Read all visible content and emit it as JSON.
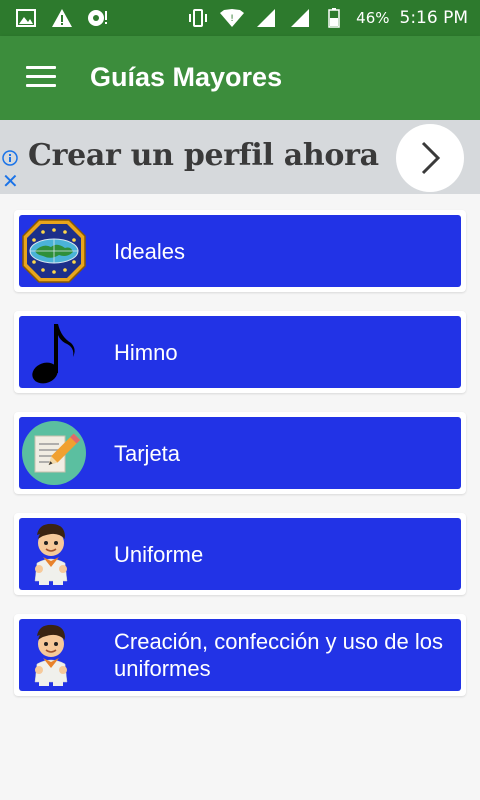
{
  "status_bar": {
    "battery_percent": "46%",
    "time": "5:16 PM"
  },
  "app_bar": {
    "title": "Guías Mayores"
  },
  "ad": {
    "text": "Crear un perfil ahora",
    "close_glyph": "✕"
  },
  "items": [
    {
      "label": "Ideales",
      "icon": "emblem-globe-icon"
    },
    {
      "label": "Himno",
      "icon": "music-note-icon"
    },
    {
      "label": "Tarjeta",
      "icon": "notepad-pencil-icon"
    },
    {
      "label": "Uniforme",
      "icon": "scout-boy-icon"
    },
    {
      "label": "Creación, confección y uso de los uniformes",
      "icon": "scout-boy-icon"
    }
  ],
  "colors": {
    "status_bar": "#2d7a2d",
    "app_bar": "#3c8d3c",
    "item_blue": "#2233e6",
    "background": "#f6f6f6"
  }
}
